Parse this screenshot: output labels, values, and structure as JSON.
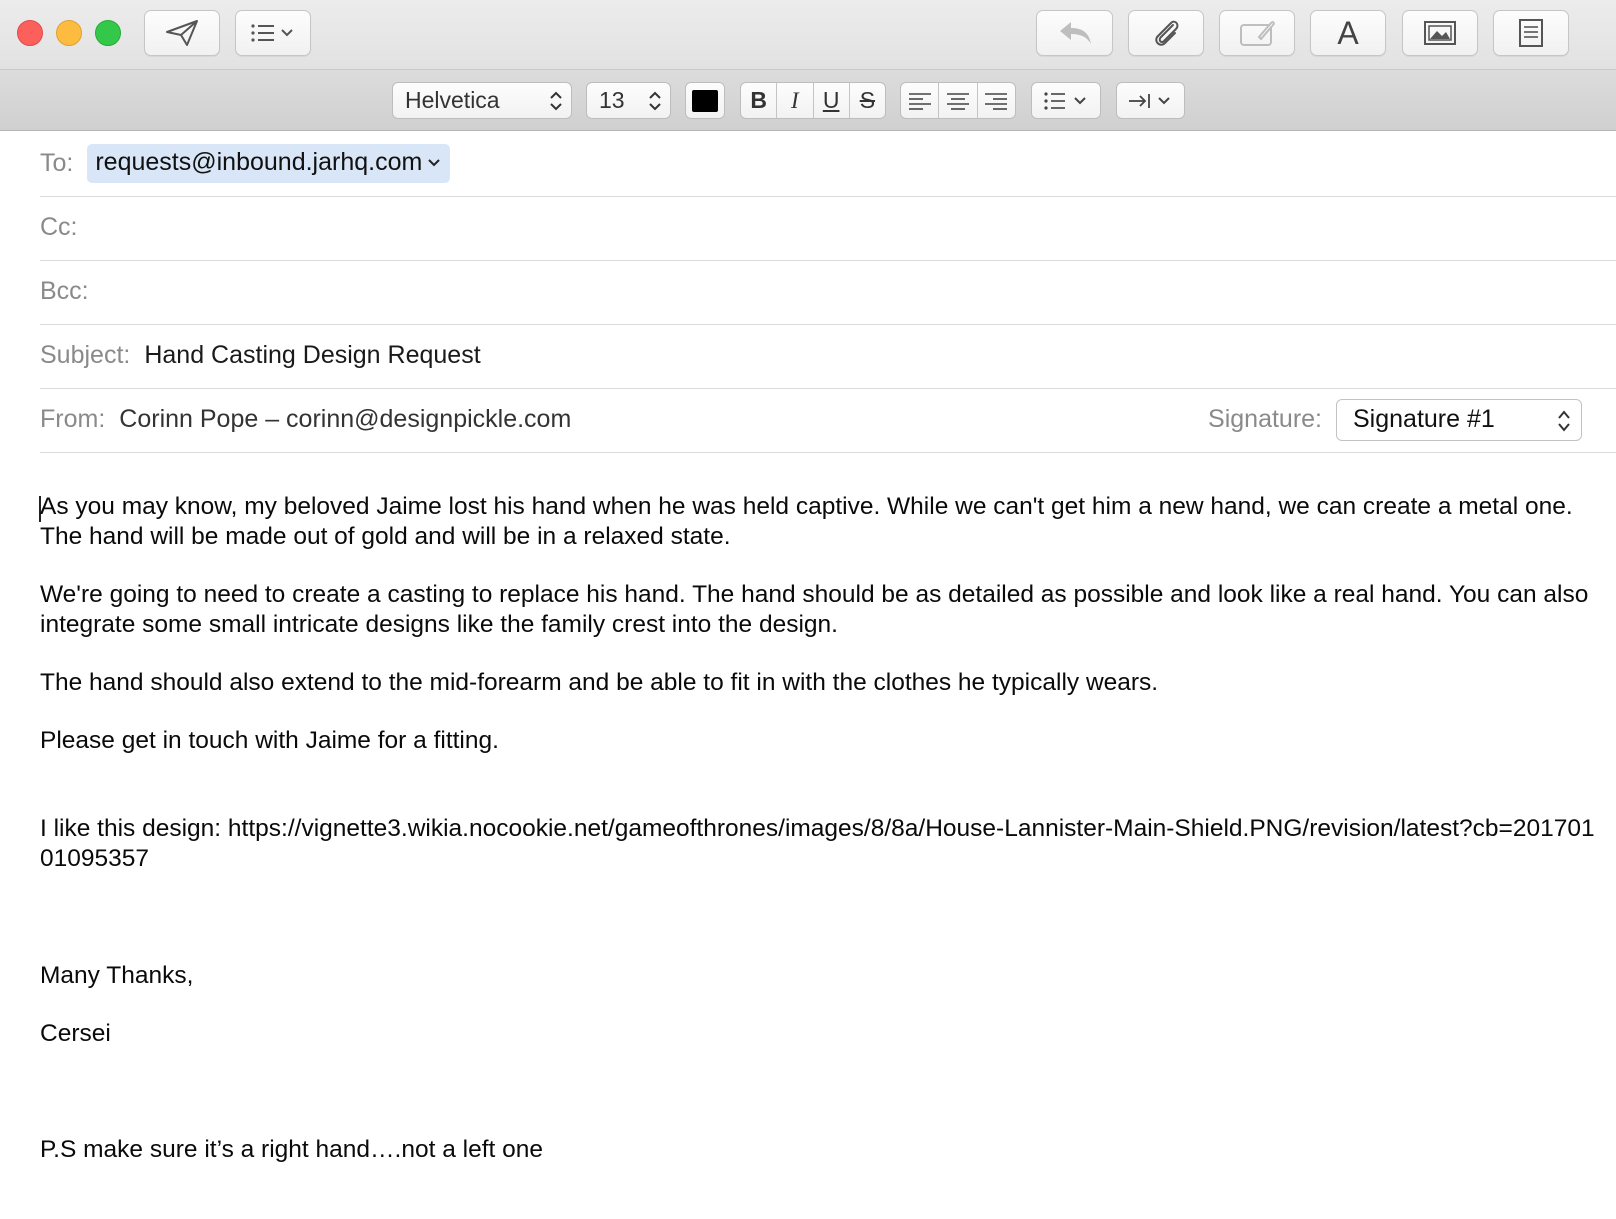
{
  "toolbar": {
    "send": "send-icon",
    "header_fields": "list-icon",
    "reply": "reply-icon",
    "attach": "paperclip-icon",
    "markup": "markup-icon",
    "fonts": "A",
    "photo_browser": "photo-icon",
    "stationery": "stationery-icon"
  },
  "format": {
    "font_family": "Helvetica",
    "font_size": "13",
    "text_color": "#000000",
    "bold": "B",
    "italic": "I",
    "underline": "U",
    "strikethrough": "S"
  },
  "fields": {
    "to_label": "To:",
    "to_value": "requests@inbound.jarhq.com",
    "cc_label": "Cc:",
    "bcc_label": "Bcc:",
    "subject_label": "Subject:",
    "subject_value": "Hand Casting Design Request",
    "from_label": "From:",
    "from_value": "Corinn Pope – corinn@designpickle.com",
    "signature_label": "Signature:",
    "signature_value": "Signature #1"
  },
  "body": {
    "p1": "As you may know, my beloved Jaime lost his hand when he was held captive. While we can't get him a new hand, we can create a metal one. The hand will be made out of gold and will be in a relaxed state.",
    "p2": "We're going to need to create a casting to replace his hand. The hand should be as detailed as possible and look like a real hand. You can also integrate some small intricate designs like the family crest into the design.",
    "p3": "The hand should also extend to the mid-forearm and be able to fit in with the clothes he typically wears.",
    "p4": "Please get in touch with Jaime for a fitting.",
    "p5": "I like this design: https://vignette3.wikia.nocookie.net/gameofthrones/images/8/8a/House-Lannister-Main-Shield.PNG/revision/latest?cb=20170101095357",
    "p6": "Many Thanks,",
    "p7": "Cersei",
    "p8": "P.S make sure it’s a right hand….not a left one"
  }
}
